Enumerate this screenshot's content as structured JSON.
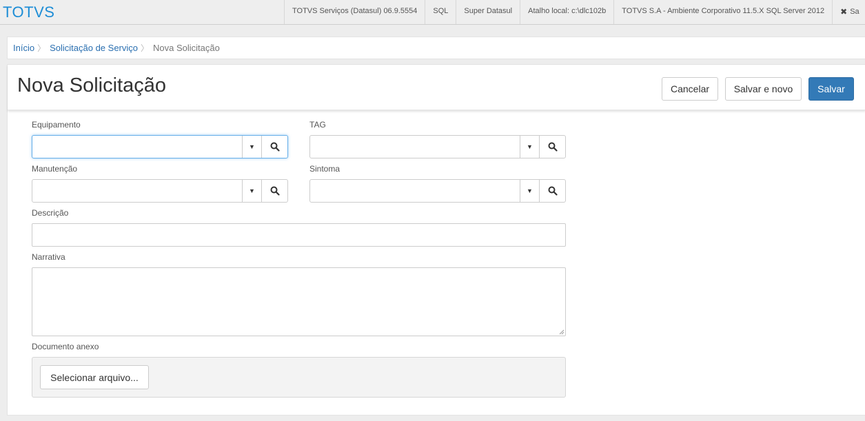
{
  "app": {
    "brand": "TOTVS",
    "topbar": [
      "TOTVS Serviços (Datasul) 06.9.5554",
      "SQL",
      "Super Datasul",
      "Atalho local: c:\\dlc102b",
      "TOTVS S.A - Ambiente Corporativo 11.5.X SQL Server 2012"
    ],
    "topbar_last": "Sa"
  },
  "breadcrumb": {
    "items": [
      "Início",
      "Solicitação de Serviço"
    ],
    "current": "Nova Solicitação"
  },
  "page": {
    "title": "Nova Solicitação",
    "buttons": {
      "cancel": "Cancelar",
      "save_new": "Salvar e novo",
      "save": "Salvar"
    }
  },
  "form": {
    "equipamento": {
      "label": "Equipamento",
      "value": ""
    },
    "tag": {
      "label": "TAG",
      "value": ""
    },
    "manutencao": {
      "label": "Manutenção",
      "value": ""
    },
    "sintoma": {
      "label": "Sintoma",
      "value": ""
    },
    "descricao": {
      "label": "Descrição",
      "value": ""
    },
    "narrativa": {
      "label": "Narrativa",
      "value": ""
    },
    "documento": {
      "label": "Documento anexo",
      "button": "Selecionar arquivo..."
    }
  },
  "colors": {
    "brand": "#1d8dd6",
    "primary": "#337ab7",
    "link": "#2a6fb0"
  }
}
